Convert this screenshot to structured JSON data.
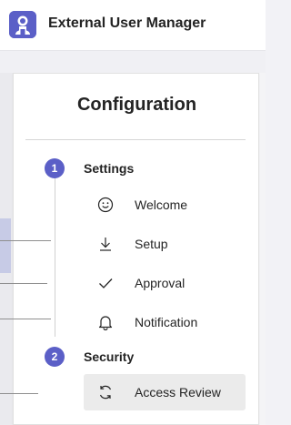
{
  "app": {
    "title": "External User Manager",
    "icon": "app-logo-icon",
    "accent_color": "#5b5fc7"
  },
  "panel": {
    "title": "Configuration",
    "steps": [
      {
        "number": "1",
        "label": "Settings",
        "items": [
          {
            "label": "Welcome",
            "icon": "smiley-face-icon"
          },
          {
            "label": "Setup",
            "icon": "download-arrow-icon"
          },
          {
            "label": "Approval",
            "icon": "checkmark-icon"
          },
          {
            "label": "Notification",
            "icon": "bell-icon"
          }
        ]
      },
      {
        "number": "2",
        "label": "Security",
        "items": [
          {
            "label": "Access Review",
            "icon": "sync-arrows-icon",
            "selected": true
          }
        ]
      }
    ]
  }
}
